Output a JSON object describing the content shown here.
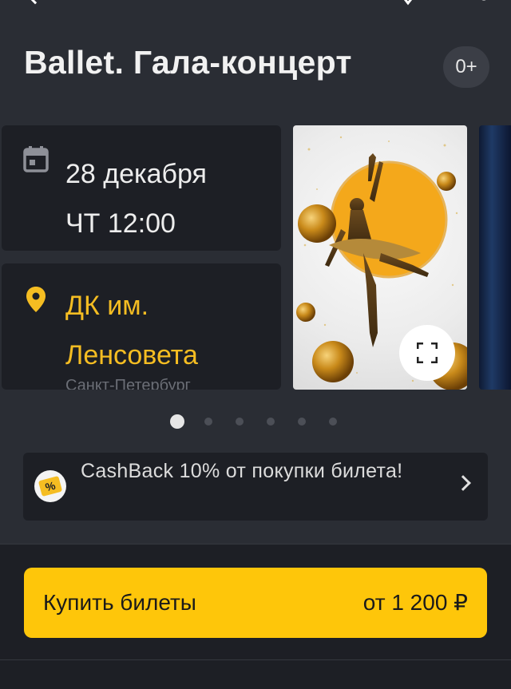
{
  "header": {
    "back_icon": "chevron-left-icon",
    "favorite_icon": "heart-icon",
    "share_icon": "share-icon"
  },
  "event": {
    "title": "Ballet. Гала-концерт",
    "age_rating": "0+"
  },
  "date_card": {
    "icon": "calendar-icon",
    "date": "28 декабря",
    "time": "ЧТ 12:00"
  },
  "location_card": {
    "icon": "map-pin-icon",
    "venue_line1": "ДК им.",
    "venue_line2": "Ленсовета",
    "address_partial": "Санкт-Петербург"
  },
  "gallery": {
    "images": [
      "ballerina-poster",
      "stage-photo"
    ],
    "active_index": 0,
    "total": 6
  },
  "cashback": {
    "icon": "ticket-percent-icon",
    "badge": "%",
    "text": "CashBack 10% от покупки билета!"
  },
  "purchase": {
    "button_label": "Купить билеты",
    "price": "от 1 200 ₽"
  },
  "colors": {
    "background": "#2a2d34",
    "card": "#1d1f25",
    "accent": "#fec60a",
    "location_text": "#f5bd22"
  }
}
